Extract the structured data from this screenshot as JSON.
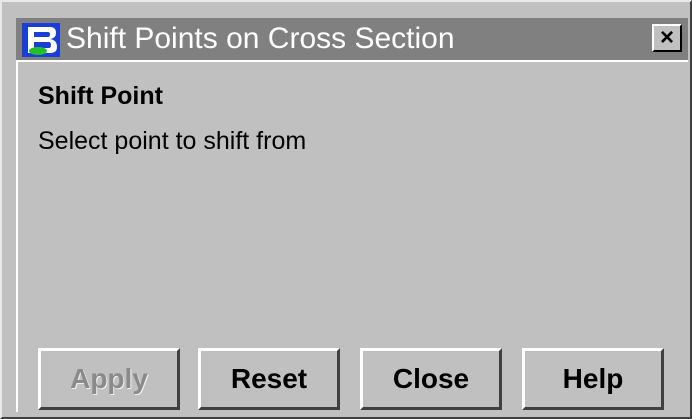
{
  "window": {
    "title": "Shift Points on Cross Section",
    "close_glyph": "×",
    "icon": "bentley-b-logo-icon",
    "titlebar_color": "#808080",
    "face_color": "#c0c0c0"
  },
  "content": {
    "heading": "Shift Point",
    "message": "Select point to shift from"
  },
  "buttons": {
    "apply": {
      "label": "Apply",
      "enabled": false
    },
    "reset": {
      "label": "Reset",
      "enabled": true
    },
    "close": {
      "label": "Close",
      "enabled": true
    },
    "help": {
      "label": "Help",
      "enabled": true
    }
  }
}
